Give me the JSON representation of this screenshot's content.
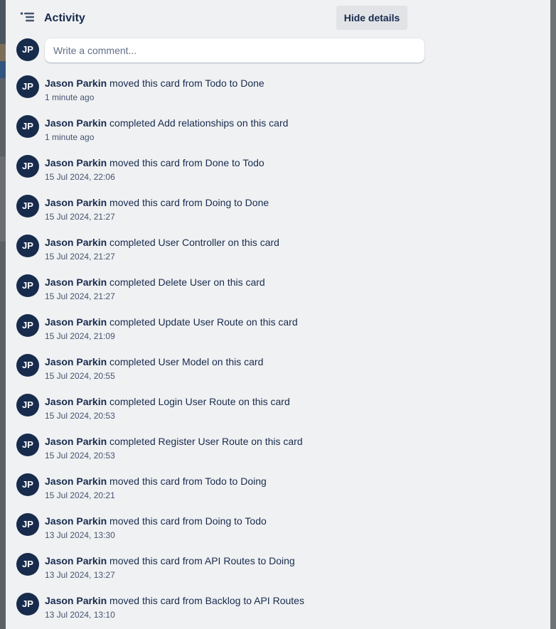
{
  "header": {
    "title": "Activity",
    "icon": "activity-list-icon",
    "hide_details_label": "Hide details"
  },
  "comment": {
    "avatar_initials": "JP",
    "placeholder": "Write a comment..."
  },
  "colors": {
    "avatar_bg": "#172b4d",
    "panel_bg": "#f0f1f3",
    "text": "#172b4d",
    "muted_text": "#44546f"
  },
  "activities": [
    {
      "initials": "JP",
      "user": "Jason Parkin",
      "action": "moved this card from Todo to Done",
      "time": "1 minute ago"
    },
    {
      "initials": "JP",
      "user": "Jason Parkin",
      "action": "completed Add relationships on this card",
      "time": "1 minute ago"
    },
    {
      "initials": "JP",
      "user": "Jason Parkin",
      "action": "moved this card from Done to Todo",
      "time": "15 Jul 2024, 22:06"
    },
    {
      "initials": "JP",
      "user": "Jason Parkin",
      "action": "moved this card from Doing to Done",
      "time": "15 Jul 2024, 21:27"
    },
    {
      "initials": "JP",
      "user": "Jason Parkin",
      "action": "completed User Controller on this card",
      "time": "15 Jul 2024, 21:27"
    },
    {
      "initials": "JP",
      "user": "Jason Parkin",
      "action": "completed Delete User on this card",
      "time": "15 Jul 2024, 21:27"
    },
    {
      "initials": "JP",
      "user": "Jason Parkin",
      "action": "completed Update User Route on this card",
      "time": "15 Jul 2024, 21:09"
    },
    {
      "initials": "JP",
      "user": "Jason Parkin",
      "action": "completed User Model on this card",
      "time": "15 Jul 2024, 20:55"
    },
    {
      "initials": "JP",
      "user": "Jason Parkin",
      "action": "completed Login User Route on this card",
      "time": "15 Jul 2024, 20:53"
    },
    {
      "initials": "JP",
      "user": "Jason Parkin",
      "action": "completed Register User Route on this card",
      "time": "15 Jul 2024, 20:53"
    },
    {
      "initials": "JP",
      "user": "Jason Parkin",
      "action": "moved this card from Todo to Doing",
      "time": "15 Jul 2024, 20:21"
    },
    {
      "initials": "JP",
      "user": "Jason Parkin",
      "action": "moved this card from Doing to Todo",
      "time": "13 Jul 2024, 13:30"
    },
    {
      "initials": "JP",
      "user": "Jason Parkin",
      "action": "moved this card from API Routes to Doing",
      "time": "13 Jul 2024, 13:27"
    },
    {
      "initials": "JP",
      "user": "Jason Parkin",
      "action": "moved this card from Backlog to API Routes",
      "time": "13 Jul 2024, 13:10"
    }
  ]
}
